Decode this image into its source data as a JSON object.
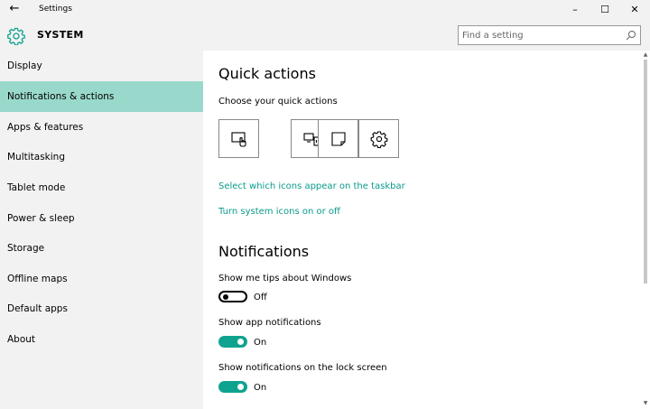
{
  "window": {
    "title": "Settings",
    "back_glyph": "←",
    "minimize_glyph": "–",
    "maximize_glyph": "☐",
    "close_glyph": "✕"
  },
  "header": {
    "icon": "gear-icon",
    "title": "SYSTEM",
    "search_placeholder": "Find a setting",
    "search_value": "",
    "search_icon": "search-icon"
  },
  "colors": {
    "accent": "#0fa38f",
    "link": "#0a9b8a",
    "selected_nav": "#99d9cb",
    "chrome": "#f2f2f2"
  },
  "sidebar": {
    "selected": "Notifications & actions",
    "items": [
      {
        "label": "Display"
      },
      {
        "label": "Notifications & actions"
      },
      {
        "label": "Apps & features"
      },
      {
        "label": "Multitasking"
      },
      {
        "label": "Tablet mode"
      },
      {
        "label": "Power & sleep"
      },
      {
        "label": "Storage"
      },
      {
        "label": "Offline maps"
      },
      {
        "label": "Default apps"
      },
      {
        "label": "About"
      }
    ]
  },
  "main": {
    "quick_actions": {
      "title": "Quick actions",
      "subtitle": "Choose your quick actions",
      "tiles": [
        {
          "icon": "tablet-mode-icon"
        },
        {
          "icon": "connect-icon"
        },
        {
          "icon": "note-icon"
        },
        {
          "icon": "settings-gear-icon"
        }
      ]
    },
    "links": {
      "taskbar_icons": "Select which icons appear on the taskbar",
      "system_icons": "Turn system icons on or off"
    },
    "notifications": {
      "title": "Notifications",
      "settings": [
        {
          "label": "Show me tips about Windows",
          "state": "Off",
          "on": false
        },
        {
          "label": "Show app notifications",
          "state": "On",
          "on": true
        },
        {
          "label": "Show notifications on the lock screen",
          "state": "On",
          "on": true
        }
      ]
    }
  }
}
